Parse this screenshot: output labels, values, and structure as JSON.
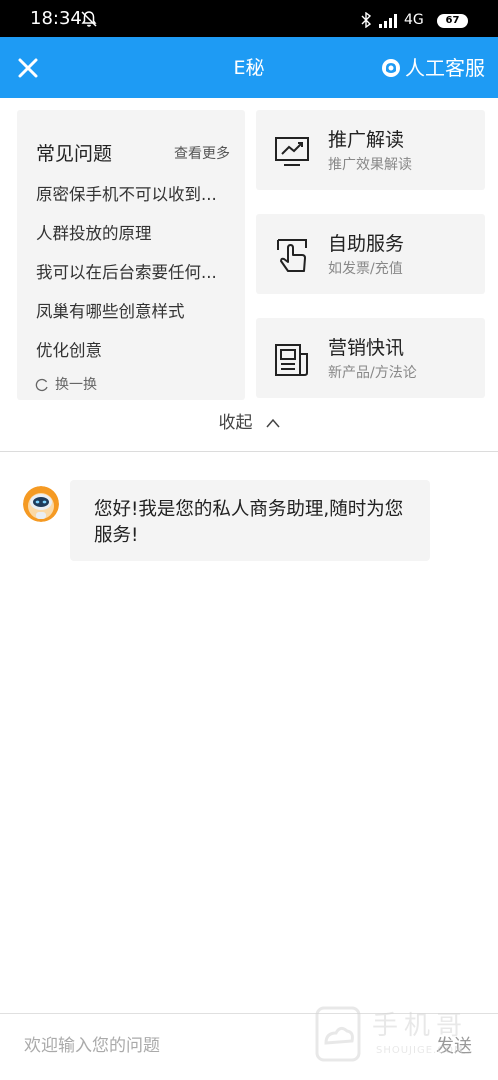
{
  "status_bar": {
    "time": "18:34",
    "network": "4G",
    "battery": "67",
    "icons": [
      "mute-bell-icon",
      "bluetooth-icon",
      "signal-icon"
    ]
  },
  "header": {
    "title": "E秘",
    "human_service_label": "人工客服",
    "background_color": "#1e9bf4",
    "icons": [
      "close-icon",
      "customer-service-icon"
    ]
  },
  "faq": {
    "title": "常见问题",
    "more_label": "查看更多",
    "items": [
      "原密保手机不可以收到...",
      "人群投放的原理",
      "我可以在后台索要任何...",
      "凤巢有哪些创意样式",
      "优化创意"
    ],
    "refresh_label": "换一换"
  },
  "services": [
    {
      "title": "推广解读",
      "subtitle": "推广效果解读",
      "icon": "trend-chart-icon"
    },
    {
      "title": "自助服务",
      "subtitle": "如发票/充值",
      "icon": "hand-pointer-icon"
    },
    {
      "title": "营销快讯",
      "subtitle": "新产品/方法论",
      "icon": "newspaper-icon"
    }
  ],
  "collapse_label": "收起",
  "chat": {
    "messages": [
      {
        "sender": "bot",
        "text": "您好!我是您的私人商务助理,随时为您服务!"
      }
    ]
  },
  "input": {
    "placeholder": "欢迎输入您的问题",
    "value": "",
    "send_label": "发送"
  },
  "watermark": {
    "text": "手机哥",
    "sub": "SHOUJIGE.COM"
  }
}
